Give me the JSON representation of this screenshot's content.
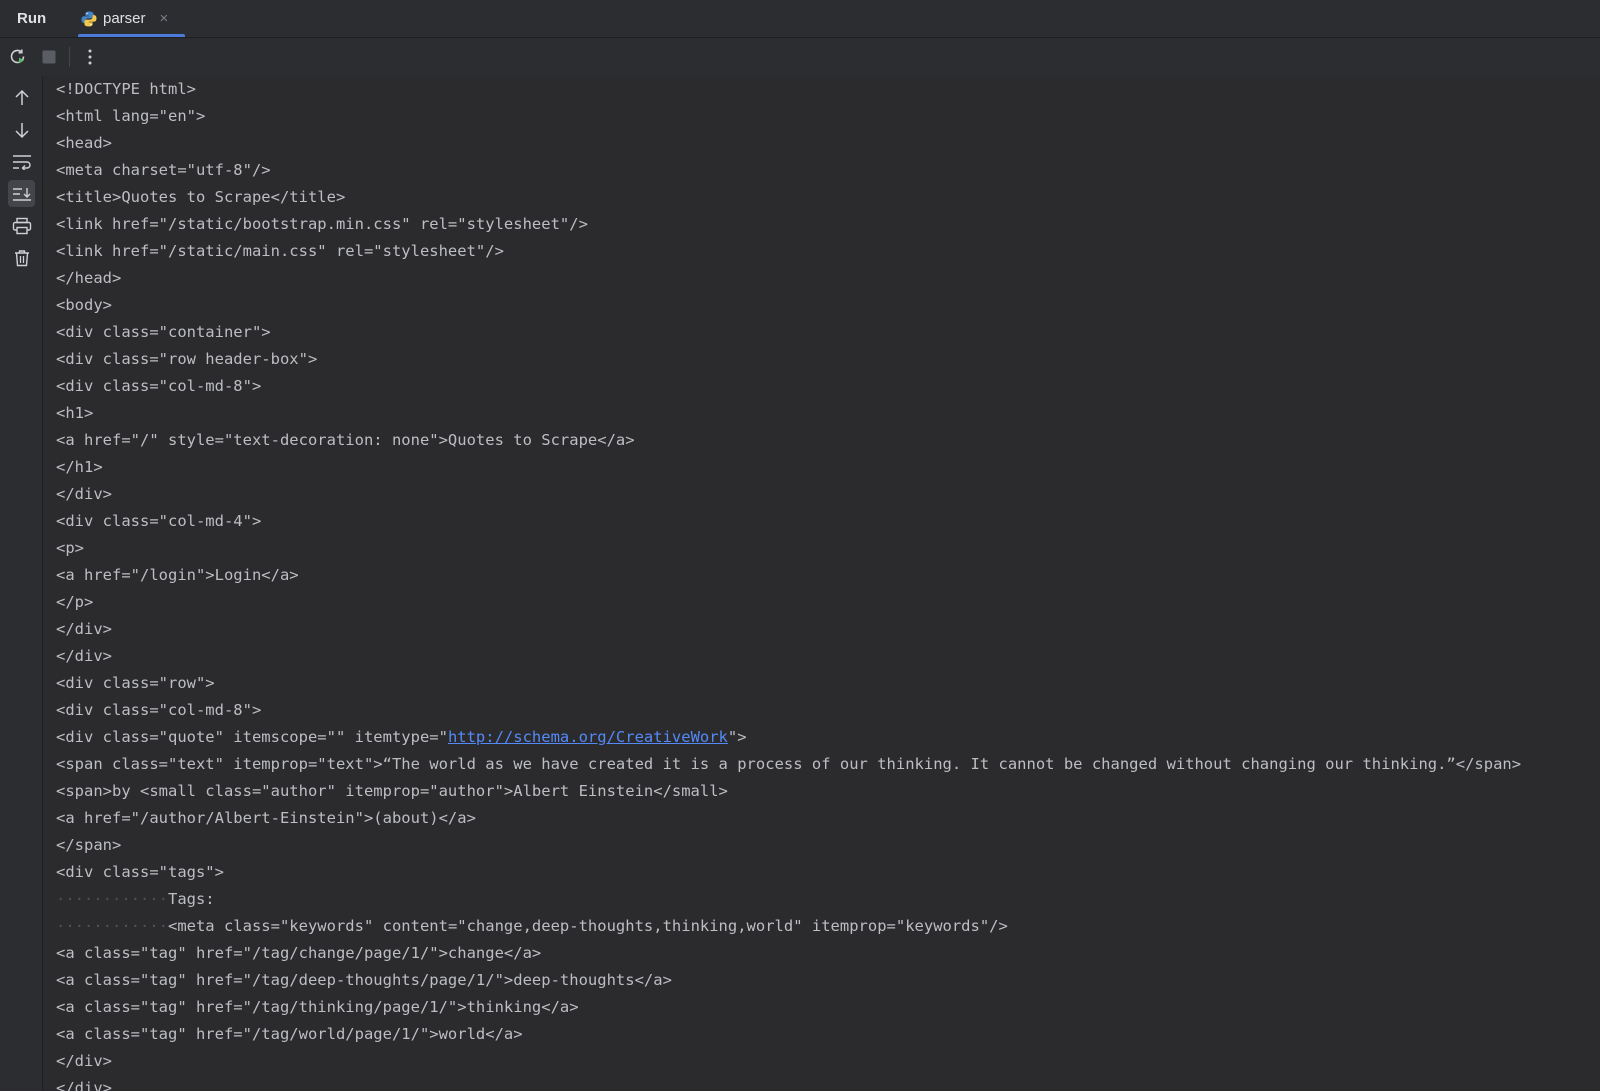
{
  "header": {
    "run_label": "Run",
    "tab_label": "parser",
    "tab_close": "×"
  },
  "toolbar": {
    "buttons": [
      "rerun-icon",
      "stop-icon",
      "more-vertical-icon"
    ]
  },
  "gutter": {
    "buttons": [
      "arrow-up-icon",
      "arrow-down-icon",
      "soft-wrap-icon",
      "scroll-to-end-icon",
      "print-icon",
      "trash-icon"
    ]
  },
  "colors": {
    "background": "#2b2d30",
    "console": "#2b2b2d",
    "text": "#bcbec4",
    "link": "#548af7",
    "accent": "#548af7"
  },
  "console": {
    "lines": [
      "<!DOCTYPE html>",
      "<html lang=\"en\">",
      "<head>",
      "<meta charset=\"utf-8\"/>",
      "<title>Quotes to Scrape</title>",
      "<link href=\"/static/bootstrap.min.css\" rel=\"stylesheet\"/>",
      "<link href=\"/static/main.css\" rel=\"stylesheet\"/>",
      "</head>",
      "<body>",
      "<div class=\"container\">",
      "<div class=\"row header-box\">",
      "<div class=\"col-md-8\">",
      "<h1>",
      "<a href=\"/\" style=\"text-decoration: none\">Quotes to Scrape</a>",
      "</h1>",
      "</div>",
      "<div class=\"col-md-4\">",
      "<p>",
      "<a href=\"/login\">Login</a>",
      "</p>",
      "</div>",
      "</div>",
      "<div class=\"row\">",
      "<div class=\"col-md-8\">"
    ],
    "link_line": {
      "before": "<div class=\"quote\" itemscope=\"\" itemtype=\"",
      "link": "http://schema.org/CreativeWork",
      "after": "\">"
    },
    "lines_after_link": [
      "<span class=\"text\" itemprop=\"text\">“The world as we have created it is a process of our thinking. It cannot be changed without changing our thinking.”</span>",
      "<span>by <small class=\"author\" itemprop=\"author\">Albert Einstein</small>",
      "<a href=\"/author/Albert-Einstein\">(about)</a>",
      "</span>",
      "<div class=\"tags\">"
    ],
    "indented_lines": [
      {
        "dots": "············",
        "text": "Tags:"
      },
      {
        "dots": "············",
        "text": "<meta class=\"keywords\" content=\"change,deep-thoughts,thinking,world\" itemprop=\"keywords\"/>"
      }
    ],
    "tail_lines": [
      "<a class=\"tag\" href=\"/tag/change/page/1/\">change</a>",
      "<a class=\"tag\" href=\"/tag/deep-thoughts/page/1/\">deep-thoughts</a>",
      "<a class=\"tag\" href=\"/tag/thinking/page/1/\">thinking</a>",
      "<a class=\"tag\" href=\"/tag/world/page/1/\">world</a>",
      "</div>",
      "</div>"
    ]
  }
}
